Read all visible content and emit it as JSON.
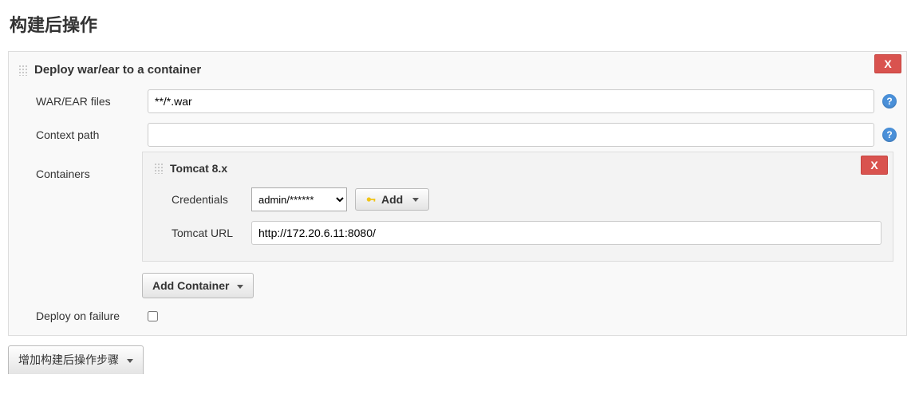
{
  "section": {
    "title": "构建后操作"
  },
  "block": {
    "title": "Deploy war/ear to a container",
    "delete_label": "X",
    "fields": {
      "war_label": "WAR/EAR files",
      "war_value": "**/*.war",
      "context_label": "Context path",
      "context_value": "",
      "containers_label": "Containers",
      "deploy_on_failure_label": "Deploy on failure"
    }
  },
  "container": {
    "title": "Tomcat 8.x",
    "delete_label": "X",
    "credentials_label": "Credentials",
    "credentials_value": "admin/******",
    "add_cred_label": "Add",
    "url_label": "Tomcat URL",
    "url_value": "http://172.20.6.11:8080/"
  },
  "buttons": {
    "add_container": "Add Container",
    "add_postbuild": "增加构建后操作步骤"
  },
  "help": {
    "glyph": "?"
  }
}
